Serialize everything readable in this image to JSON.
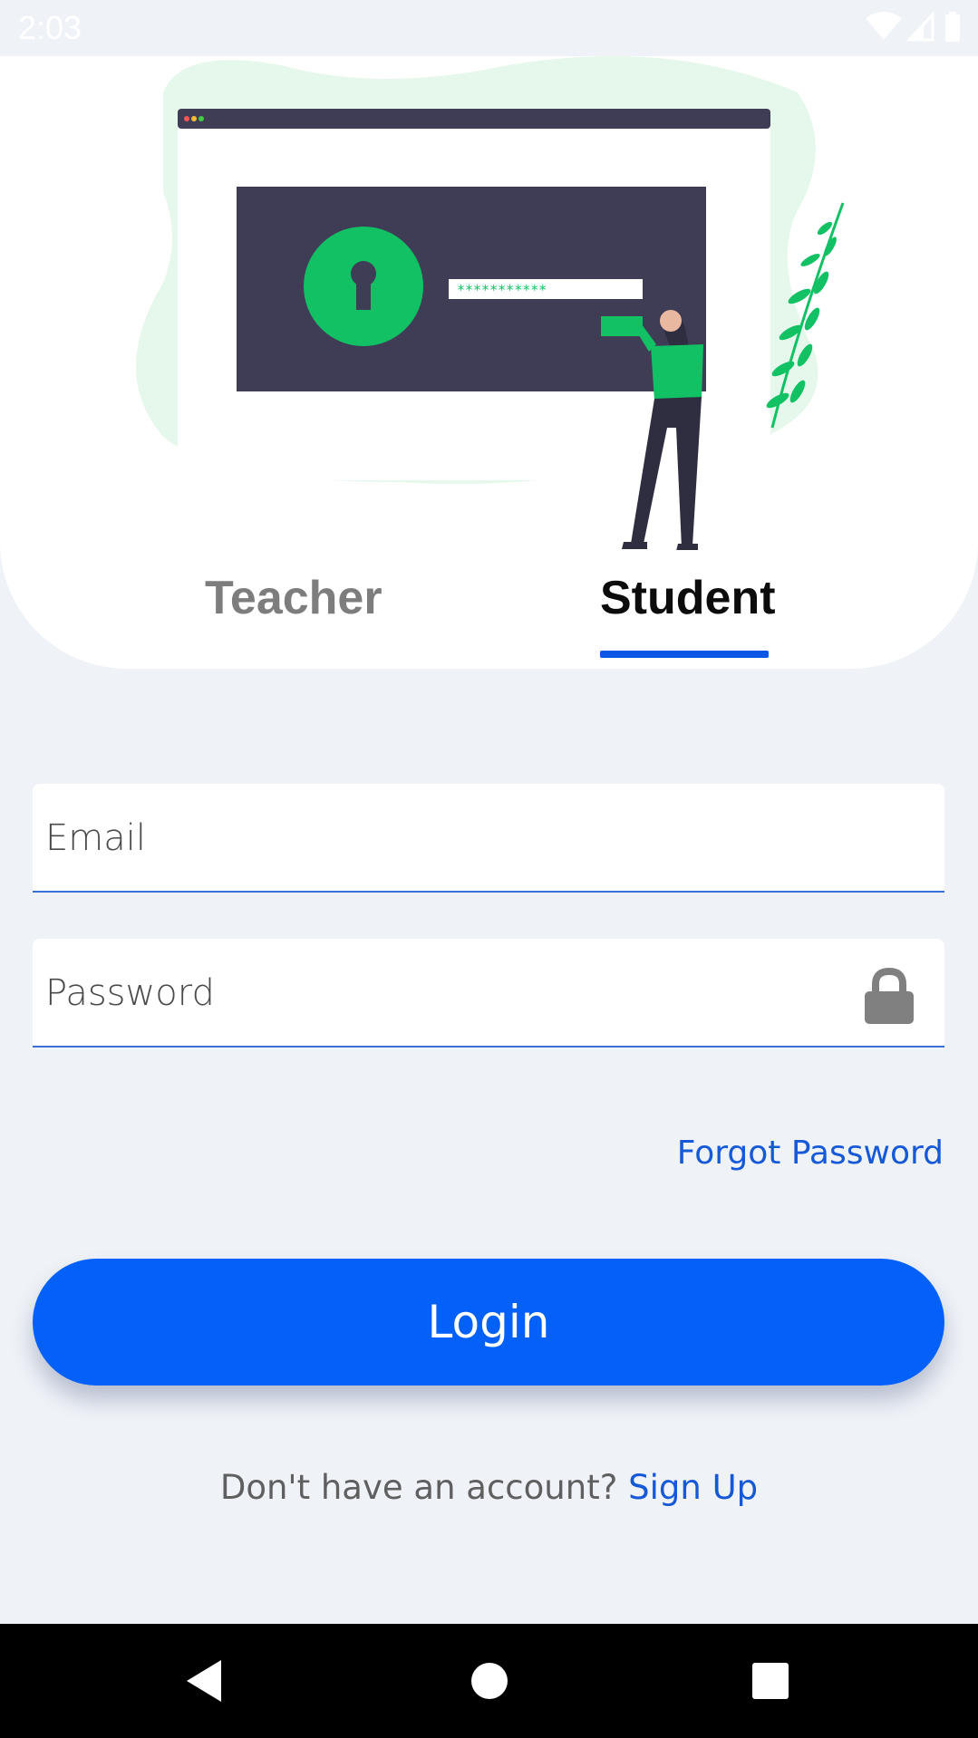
{
  "status_bar": {
    "time": "2:03",
    "icons": [
      "wifi-icon",
      "signal-icon",
      "battery-icon"
    ]
  },
  "tabs": [
    {
      "label": "Teacher",
      "selected": false
    },
    {
      "label": "Student",
      "selected": true
    }
  ],
  "form": {
    "email": {
      "placeholder": "Email",
      "value": ""
    },
    "password": {
      "placeholder": "Password",
      "value": ""
    },
    "forgot_label": "Forgot Password",
    "login_label": "Login"
  },
  "signup": {
    "prompt": "Don't have an account?",
    "link_label": "Sign Up"
  },
  "illustration": {
    "password_mask": "***********"
  },
  "colors": {
    "accent": "#0361fa",
    "link": "#1559d8",
    "tab_indicator": "#0a57e6",
    "illustration_green": "#12c164",
    "illustration_dark": "#3f3d56"
  },
  "nav_bar": {
    "buttons": [
      "back-icon",
      "home-icon",
      "recents-icon"
    ]
  }
}
